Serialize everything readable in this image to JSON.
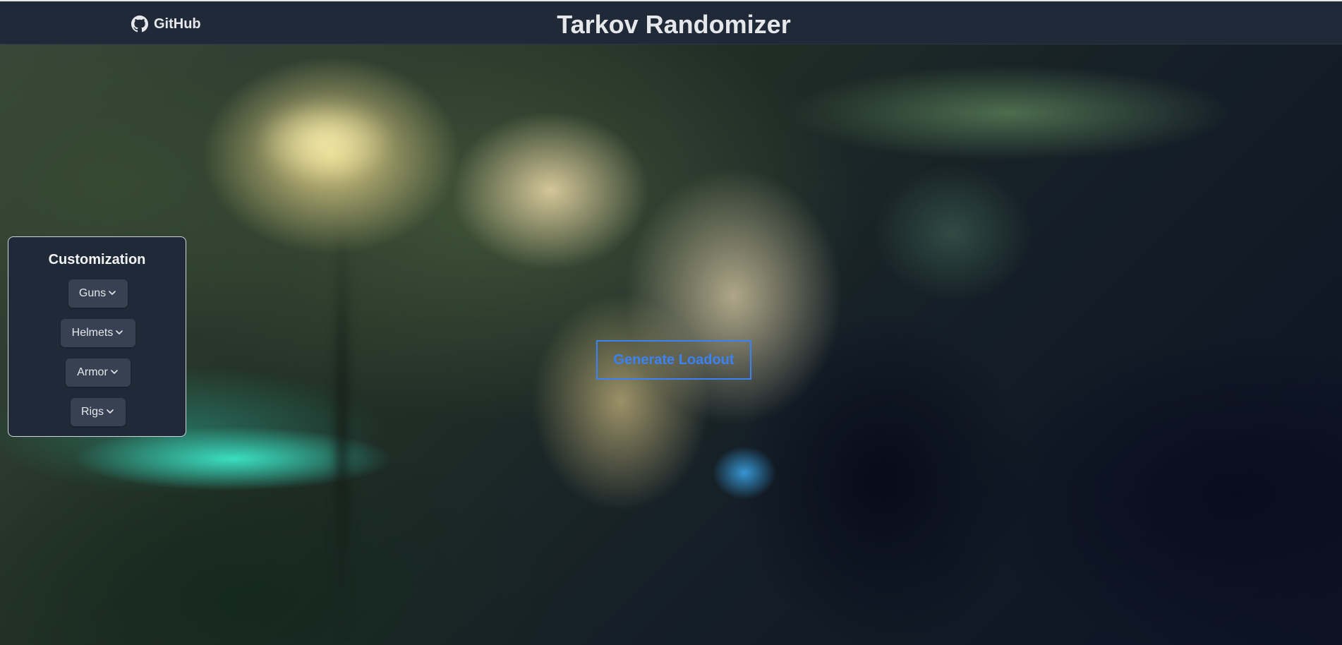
{
  "header": {
    "github_label": "GitHub",
    "github_icon": "github-icon",
    "title": "Tarkov Randomizer"
  },
  "customization": {
    "title": "Customization",
    "dropdowns": [
      {
        "label": "Guns",
        "icon": "chevron-down-icon"
      },
      {
        "label": "Helmets",
        "icon": "chevron-down-icon"
      },
      {
        "label": "Armor",
        "icon": "chevron-down-icon"
      },
      {
        "label": "Rigs",
        "icon": "chevron-down-icon"
      }
    ]
  },
  "main": {
    "generate_label": "Generate Loadout"
  },
  "colors": {
    "header_bg": "#1f2937",
    "panel_bg": "#1f2937",
    "dropdown_bg": "#374151",
    "accent": "#3b82f6",
    "text": "#e5e7eb"
  }
}
